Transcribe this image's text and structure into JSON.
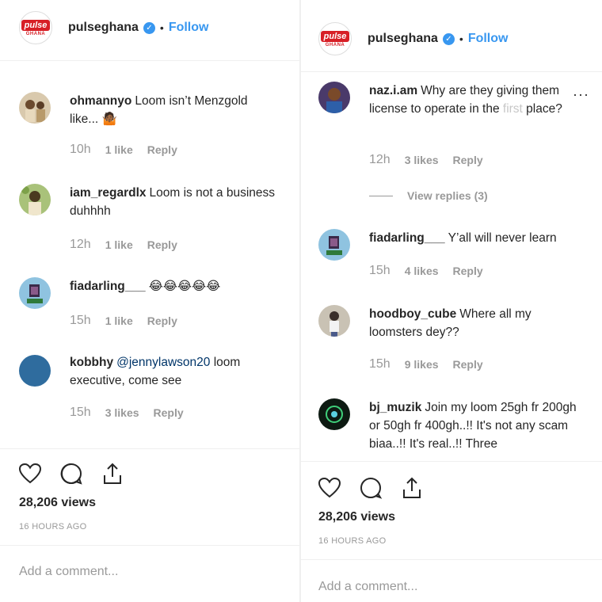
{
  "left": {
    "header": {
      "handle": "pulseghana",
      "dot": "•",
      "follow": "Follow",
      "logo_top": "pulse",
      "logo_bottom": "GHANA"
    },
    "comments": [
      {
        "user": "ohmannyo",
        "text": "Loom isn’t Menzgold like... 🤷🏾",
        "time": "10h",
        "likes": "1 like",
        "reply": "Reply"
      },
      {
        "user": "iam_regardlx",
        "text": "Loom is not a business duhhhh",
        "time": "12h",
        "likes": "1 like",
        "reply": "Reply"
      },
      {
        "user": "fiadarling___",
        "text": "😂😂😂😂😂",
        "time": "15h",
        "likes": "1 like",
        "reply": "Reply"
      },
      {
        "user": "kobbhy",
        "mention": "@jennylawson20",
        "text": " loom executive, come see",
        "time": "15h",
        "likes": "3 likes",
        "reply": "Reply"
      }
    ],
    "views": "28,206 views",
    "ago": "16 HOURS AGO",
    "add_comment": "Add a comment..."
  },
  "right": {
    "header": {
      "handle": "pulseghana",
      "dot": "•",
      "follow": "Follow",
      "logo_top": "pulse",
      "logo_bottom": "GHANA"
    },
    "comments": [
      {
        "user": "naz.i.am",
        "text_main": "Why are they giving them license to operate in the ",
        "text_fade": "first",
        "text_end": " place?",
        "time": "12h",
        "likes": "3 likes",
        "reply": "Reply",
        "more": "···"
      },
      {
        "user": "fiadarling___",
        "text": "Y’all will never learn",
        "time": "15h",
        "likes": "4 likes",
        "reply": "Reply"
      },
      {
        "user": "hoodboy_cube",
        "text": "Where all my loomsters dey??",
        "time": "15h",
        "likes": "9 likes",
        "reply": "Reply"
      },
      {
        "user": "bj_muzik",
        "text": "Join my loom 25gh fr 200gh or 50gh fr 400gh..!! It's not any scam biaa..!! It's real..!! Three"
      }
    ],
    "view_replies": "View replies (3)",
    "views": "28,206 views",
    "ago": "16 HOURS AGO",
    "add_comment": "Add a comment..."
  },
  "icons": [
    "heart-icon",
    "comment-icon",
    "share-icon",
    "verified-icon"
  ],
  "colors": {
    "accent": "#3897f0",
    "brand": "#d71f26",
    "muted": "#999999",
    "text": "#262626"
  }
}
